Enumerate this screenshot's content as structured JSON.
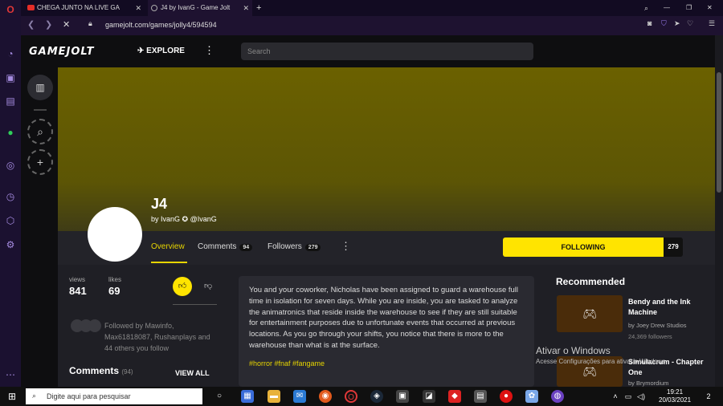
{
  "browser": {
    "tabs": [
      {
        "title": "CHEGA JUNTO NA LIVE GA",
        "active": false
      },
      {
        "title": "J4 by IvanG - Game Jolt",
        "active": true
      }
    ],
    "new_tab": "+",
    "url": "gamejolt.com/games/jolly4/594594"
  },
  "gamejolt": {
    "logo": "GAMEJOLT",
    "explore": "EXPLORE",
    "search_placeholder": "Search"
  },
  "game": {
    "title": "J4",
    "by_label": "by IvanG",
    "handle": "@IvanG",
    "nav": {
      "overview": "Overview",
      "comments": "Comments",
      "comments_count": "94",
      "followers": "Followers",
      "followers_count": "279"
    },
    "following_label": "FOLLOWING",
    "following_count": "279",
    "views_label": "views",
    "views": "841",
    "likes_label": "likes",
    "likes": "69",
    "followed_by": "Followed by Mawinfo, Max61818087, Rushanplays and 44 others you follow",
    "comments_heading": "Comments",
    "comments_count": "(94)",
    "view_all": "VIEW ALL",
    "description": "You and your coworker, Nicholas have been assigned to guard a warehouse full time in isolation for seven days. While you are inside, you are tasked to analyze the animatronics that reside inside the warehouse to see if they are still suitable for entertainment purposes due to unfortunate events that occurred at previous locations. As you go through your shifts, you notice that there is more to the warehouse than what is at the surface.",
    "tags": "#horror #fnaf #fangame"
  },
  "recommended": {
    "heading": "Recommended",
    "items": [
      {
        "title": "Bendy and the Ink Machine",
        "dev": "by Joey Drew Studios",
        "followers": "24,369 followers"
      },
      {
        "title": "Simulacrum - Chapter One",
        "dev": "by Brymordium",
        "followers": ""
      }
    ]
  },
  "watermark": {
    "title": "Ativar o Windows",
    "subtitle": "Acesse Configurações para ativar o Windows."
  },
  "taskbar": {
    "search_placeholder": "Digite aqui para pesquisar",
    "time": "19:21",
    "date": "20/03/2021",
    "notifications": "2"
  },
  "colors": {
    "accent": "#ffe400",
    "opera_sidebar": "#1b1130",
    "banner": "#6b6100"
  }
}
